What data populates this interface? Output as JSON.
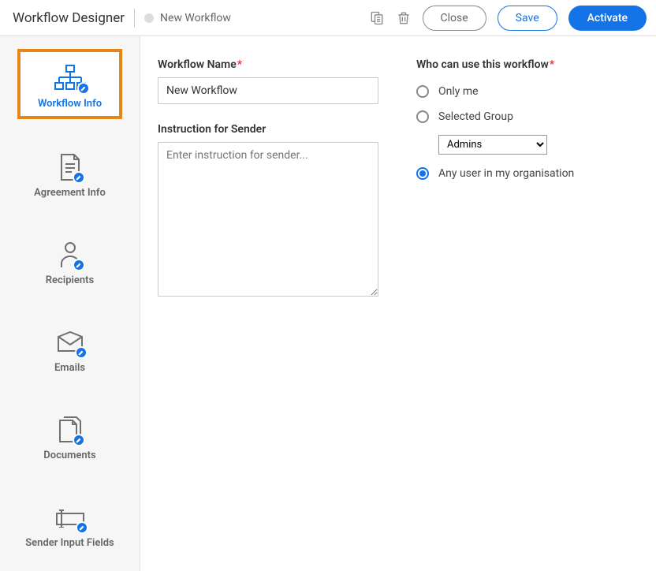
{
  "header": {
    "app_title": "Workflow Designer",
    "workflow_title": "New Workflow",
    "close_label": "Close",
    "save_label": "Save",
    "activate_label": "Activate"
  },
  "sidebar": {
    "items": [
      {
        "label": "Workflow Info",
        "active": true
      },
      {
        "label": "Agreement Info"
      },
      {
        "label": "Recipients"
      },
      {
        "label": "Emails"
      },
      {
        "label": "Documents"
      },
      {
        "label": "Sender Input Fields"
      }
    ]
  },
  "form": {
    "name_label": "Workflow Name",
    "name_value": "New Workflow",
    "instruction_label": "Instruction for Sender",
    "instruction_placeholder": "Enter instruction for sender...",
    "who_label": "Who can use this workflow",
    "only_me": "Only me",
    "selected_group": "Selected Group",
    "group_value": "Admins",
    "any_user": "Any user in my organisation"
  }
}
